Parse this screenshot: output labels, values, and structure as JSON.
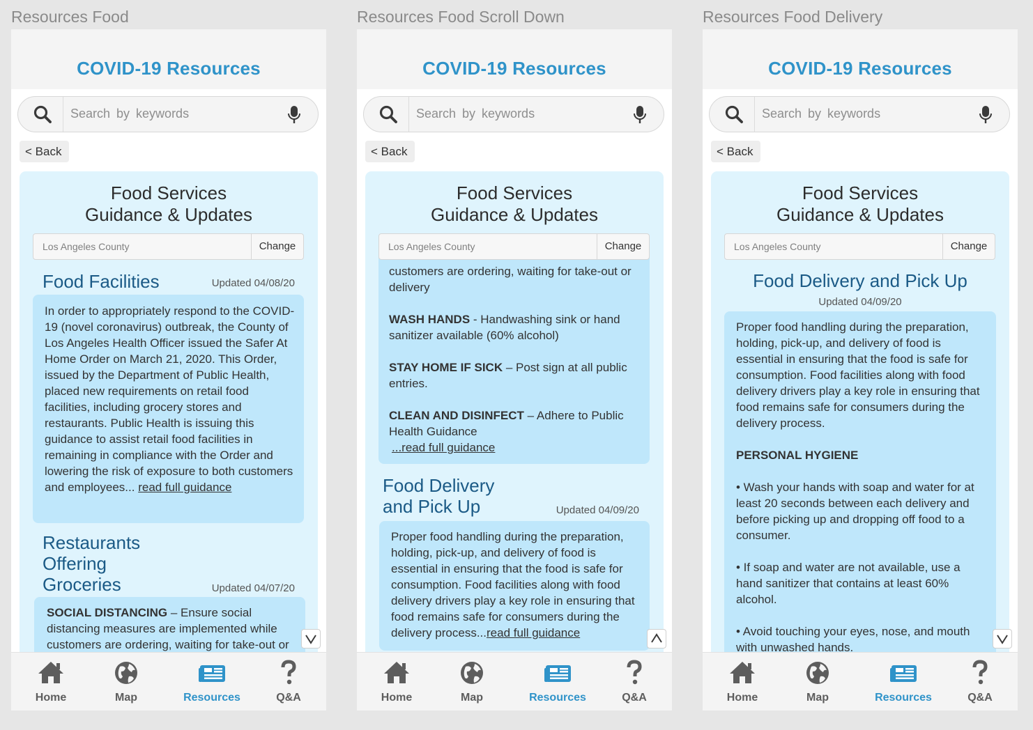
{
  "frames": [
    {
      "label": "Resources Food",
      "app_title": "COVID-19 Resources",
      "search_placeholder": "Search by keywords",
      "back": "< Back",
      "card_title_1": "Food Services",
      "card_title_2": "Guidance & Updates",
      "county": "Los Angeles County",
      "change": "Change",
      "sec1_title": "Food Facilities",
      "sec1_updated": "Updated 04/08/20",
      "sec1_text": "In order to appropriately respond to the COVID-19 (novel coronavirus) outbreak, the County of Los Angeles Health Officer issued the Safer At Home Order on March 21, 2020. This Order, issued by the Department of Public Health, placed new requirements on retail food facilities, including grocery stores and restaurants. Public Health is issuing this guidance to assist retail food facilities in remaining in compliance with the Order and lowering the risk of exposure to both customers and employees... ",
      "sec1_link": "read full guidance",
      "sec2_title_1": "Restaurants",
      "sec2_title_2": "Offering",
      "sec2_title_3": "Groceries",
      "sec2_updated": "Updated 04/07/20",
      "sec2_bold": "SOCIAL DISTANCING",
      "sec2_text": " – Ensure social distancing measures are implemented while customers are ordering, waiting for take-out or"
    },
    {
      "label": "Resources Food Scroll Down",
      "app_title": "COVID-19 Resources",
      "search_placeholder": "Search by keywords",
      "back": "< Back",
      "card_title_1": "Food Services",
      "card_title_2": "Guidance & Updates",
      "county": "Los Angeles County",
      "change": "Change",
      "cont_text": "customers are ordering, waiting for take-out or delivery",
      "wash_bold": "WASH HANDS",
      "wash_text": " - Handwashing sink or hand sanitizer available (60% alcohol)",
      "sick_bold": "STAY HOME IF SICK",
      "sick_text": " – Post sign at all public entries.",
      "clean_bold": "CLEAN AND DISINFECT",
      "clean_text": " – Adhere to Public Health  Guidance",
      "clean_link": "...read full guidance",
      "sec3_title_1": "Food Delivery",
      "sec3_title_2": "and Pick Up",
      "sec3_updated": "Updated 04/09/20",
      "sec3_text": "Proper food handling during the preparation, holding, pick-up, and delivery of food is essential in ensuring that the food is safe for consumption. Food facilities along with food delivery drivers play a key role in ensuring that food remains safe for consumers during the delivery process...",
      "sec3_link": "read full guidance"
    },
    {
      "label": "Resources Food Delivery",
      "app_title": "COVID-19 Resources",
      "search_placeholder": "Search by keywords",
      "back": "< Back",
      "card_title_1": "Food Services",
      "card_title_2": "Guidance & Updates",
      "county": "Los Angeles County",
      "change": "Change",
      "sec_title": "Food Delivery and Pick Up",
      "sec_updated": "Updated 04/09/20",
      "p1": "Proper food handling during the preparation, holding, pick-up, and delivery of food is essential in ensuring that the food is safe for consumption. Food facilities along with food delivery drivers play a key role in ensuring that food remains safe for consumers during the delivery process.",
      "p2": "PERSONAL HYGIENE",
      "p3": "• Wash your hands with soap and water for at least 20 seconds between each delivery and before picking up and dropping off food to a consumer.",
      "p4": "• If soap and water are not available, use a hand sanitizer that contains at least 60% alcohol.",
      "p5": "• Avoid touching your eyes, nose, and mouth with unwashed hands."
    }
  ],
  "tabs": {
    "home": "Home",
    "map": "Map",
    "resources": "Resources",
    "qa": "Q&A"
  },
  "colors": {
    "brand": "#2f93c9",
    "heading": "#1b5a86",
    "card": "#dff4fd",
    "content_box": "#bfe7fb"
  },
  "icons": [
    "search-icon",
    "microphone-icon",
    "home-icon",
    "globe-icon",
    "newspaper-icon",
    "question-icon",
    "chevron-down-icon",
    "chevron-up-icon"
  ]
}
